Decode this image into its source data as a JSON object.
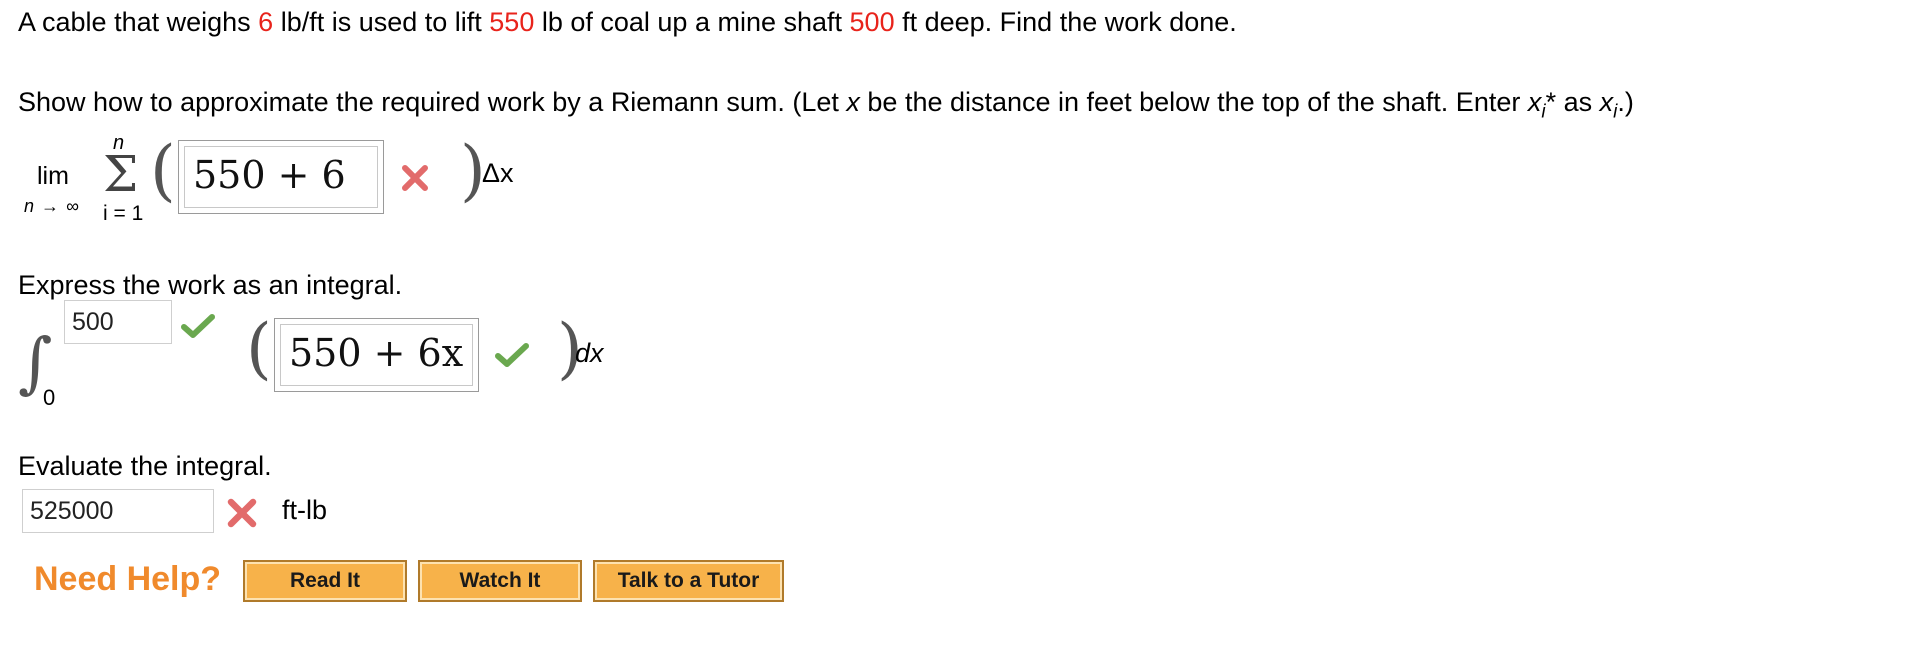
{
  "problem": {
    "p1": "A cable that weighs ",
    "weight": "6",
    "p2": " lb/ft is used to lift ",
    "load": "550",
    "p3": " lb of coal up a mine shaft ",
    "depth": "500",
    "p4": " ft deep. Find the work done."
  },
  "riemann_prompt": {
    "p1": "Show how to approximate the required work by a Riemann sum. (Let ",
    "x": "x",
    "p2": " be the distance in feet below the top of the shaft. Enter ",
    "xi": "x",
    "i_sub": "i",
    "star": "*",
    "p3": " as ",
    "xi2": "x",
    "i_sub2": "i",
    "p4": ".)"
  },
  "riemann": {
    "lim": "lim",
    "lim_sub": "n → ∞",
    "sum_top": "n",
    "sum_symbol": "Σ",
    "sum_bottom": "i = 1",
    "open_paren": "(",
    "close_paren": ")",
    "answer": "550 + 6",
    "delta": "Δx",
    "status": "incorrect"
  },
  "integral_prompt": "Express the work as an integral.",
  "integral": {
    "upper": "500",
    "lower": "0",
    "symbol": "∫",
    "open_paren": "(",
    "close_paren": ")",
    "integrand": "550 + 6x",
    "dx": "dx",
    "upper_status": "correct",
    "integrand_status": "correct"
  },
  "evaluate_prompt": "Evaluate the integral.",
  "evaluate": {
    "value": "525000",
    "unit": "ft-lb",
    "status": "incorrect"
  },
  "help": {
    "label": "Need Help?",
    "buttons": [
      "Read It",
      "Watch It",
      "Talk to a Tutor"
    ]
  },
  "colors": {
    "highlight": "#e8231b",
    "check": "#6aa84f",
    "cross": "#e26b6b",
    "help_orange": "#f08a2c",
    "button": "#f7b24a"
  },
  "icons": {
    "correct": "check-icon",
    "incorrect": "x-icon"
  }
}
